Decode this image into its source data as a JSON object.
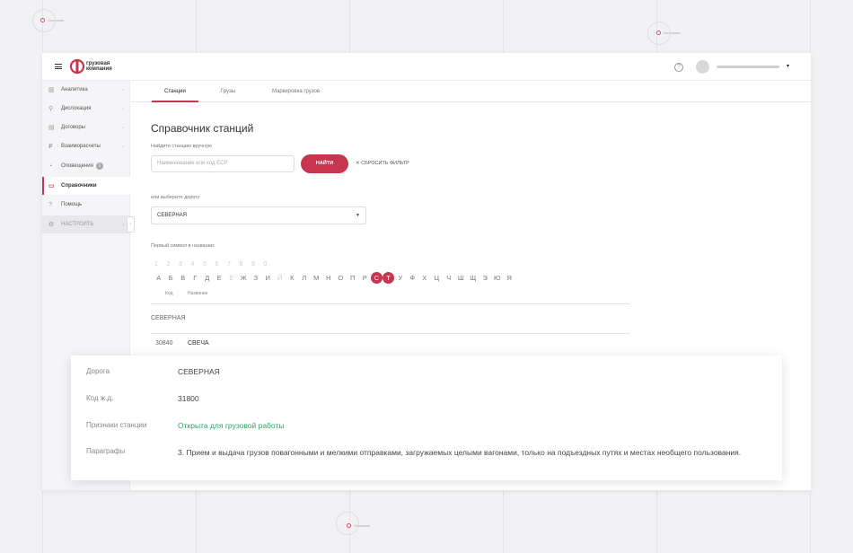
{
  "background": {
    "markers": [
      "Описание",
      "Описание",
      "Описание"
    ]
  },
  "header": {
    "logo_line1": "грузовая",
    "logo_line2": "компания",
    "help_icon": "question-circle-icon",
    "user_caret": "▾"
  },
  "sidebar": {
    "items": [
      {
        "label": "Аналитика",
        "icon": "▥"
      },
      {
        "label": "Дислокация",
        "icon": "⚲"
      },
      {
        "label": "Договоры",
        "icon": "▤"
      },
      {
        "label": "Взаиморасчеты",
        "icon": "₽"
      },
      {
        "label": "Оповещения",
        "icon": "◔",
        "badge": "1"
      },
      {
        "label": "Справочники",
        "icon": "▭"
      },
      {
        "label": "Помощь",
        "icon": "?"
      },
      {
        "label": "НАСТРОИТЬ",
        "icon": "⚙"
      }
    ],
    "collapse_glyph": "‹"
  },
  "tabs": [
    {
      "label": "Станции"
    },
    {
      "label": "Грузы"
    },
    {
      "label": "Маркировка грузов"
    }
  ],
  "main": {
    "title": "Справочник станций",
    "search_label": "Найдите станцию вручную",
    "search_placeholder": "Наименование или код ЕСР",
    "find_button": "НАЙТИ",
    "reset_filter": "✕ СБРОСИТЬ ФИЛЬТР",
    "road_label": "или выберите дорогу",
    "road_value": "СЕВЕРНАЯ",
    "first_symbol_label": "Первый символ в названии:",
    "digits": [
      "1",
      "2",
      "3",
      "4",
      "5",
      "6",
      "7",
      "8",
      "9",
      "0"
    ],
    "letters": [
      {
        "ch": "А"
      },
      {
        "ch": "Б"
      },
      {
        "ch": "В"
      },
      {
        "ch": "Г"
      },
      {
        "ch": "Д"
      },
      {
        "ch": "Е"
      },
      {
        "ch": "Ё",
        "dim": true
      },
      {
        "ch": "Ж"
      },
      {
        "ch": "З"
      },
      {
        "ch": "И"
      },
      {
        "ch": "Й",
        "dim": true
      },
      {
        "ch": "К"
      },
      {
        "ch": "Л"
      },
      {
        "ch": "М"
      },
      {
        "ch": "Н"
      },
      {
        "ch": "О"
      },
      {
        "ch": "П"
      },
      {
        "ch": "Р"
      },
      {
        "ch": "С",
        "sel": true
      },
      {
        "ch": "Т",
        "sel": true
      },
      {
        "ch": "У"
      },
      {
        "ch": "Ф"
      },
      {
        "ch": "Х"
      },
      {
        "ch": "Ц"
      },
      {
        "ch": "Ч"
      },
      {
        "ch": "Ш"
      },
      {
        "ch": "Щ"
      },
      {
        "ch": "Э"
      },
      {
        "ch": "Ю"
      },
      {
        "ch": "Я"
      }
    ],
    "col_code": "Код",
    "col_name": "Название",
    "group_road": "СЕВЕРНАЯ",
    "row": {
      "code": "30840",
      "name": "СВЕЧА"
    }
  },
  "detail": {
    "road_key": "Дорога",
    "road_val": "СЕВЕРНАЯ",
    "code_key": "Код ж.д.",
    "code_val": "31800",
    "signs_key": "Признаки станции",
    "signs_val": "Открыта для грузовой работы",
    "para_key": "Параграфы",
    "para_val": "3. Прием и выдача грузов повагонными и мелкими отправками, загружаемых целыми вагонами, только на подъездных путях и местах необщего пользования."
  },
  "colors": {
    "accent": "#c8354f",
    "green": "#2aa564"
  }
}
